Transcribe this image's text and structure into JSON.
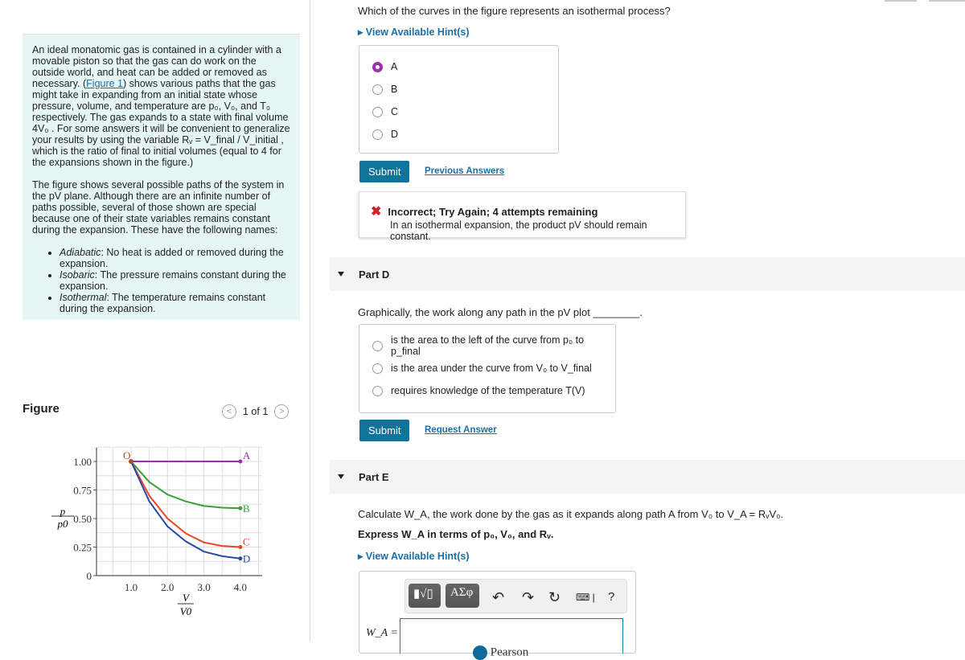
{
  "intro": {
    "p1_a": "An ideal monatomic gas is contained in a cylinder with a movable piston so that the gas can do work on the outside world, and heat can be added or removed as necessary. (",
    "figure_link": "Figure 1",
    "p1_b": ") shows various paths that the gas might take in expanding from an initial state whose pressure, volume, and temperature are p₀, V₀, and T₀ respectively. The gas expands to a state with final volume 4V₀ . For some answers it will be convenient to generalize your results by using the variable Rᵥ = V_final / V_initial , which is the ratio of final to initial volumes (equal to 4 for the expansions shown in the figure.)",
    "p2": "The figure shows several possible paths of the system in the pV plane. Although there are an infinite number of paths possible, several of those shown are special because one of their state variables remains constant during the expansion. These have the following names:",
    "bullets": [
      {
        "term": "Adiabatic",
        "text": ": No heat is added or removed during the expansion."
      },
      {
        "term": "Isobaric",
        "text": ": The pressure remains constant during the expansion."
      },
      {
        "term": "Isothermal",
        "text": ": The temperature remains constant during the expansion."
      }
    ]
  },
  "figure": {
    "title": "Figure",
    "pager": "1 of 1",
    "prev_icon": "chevron-left",
    "next_icon": "chevron-right"
  },
  "chart_data": {
    "type": "line",
    "ylabel_num": "p",
    "ylabel_den": "p0",
    "xlabel_num": "V",
    "xlabel_den": "V0",
    "xticks": [
      "1.0",
      "2.0",
      "3.0",
      "4.0"
    ],
    "yticks": [
      "0",
      "0.25",
      "0.50",
      "0.75",
      "1.00"
    ],
    "xlim": [
      0,
      4.6
    ],
    "ylim": [
      0,
      1.12
    ],
    "grid": true,
    "origin_label": "O",
    "series": [
      {
        "name": "A",
        "color": "#9b2fae",
        "x": [
          1,
          4
        ],
        "y": [
          1,
          1
        ]
      },
      {
        "name": "B",
        "color": "#3a9e3a",
        "x": [
          1,
          1.5,
          2,
          2.5,
          3,
          3.5,
          4
        ],
        "y": [
          1,
          0.82,
          0.71,
          0.65,
          0.61,
          0.595,
          0.59
        ]
      },
      {
        "name": "C",
        "color": "#ee4422",
        "x": [
          1,
          1.5,
          2,
          2.5,
          3,
          3.5,
          4
        ],
        "y": [
          1,
          0.7,
          0.5,
          0.37,
          0.29,
          0.26,
          0.25
        ]
      },
      {
        "name": "D",
        "color": "#2a4aa8",
        "x": [
          1,
          1.5,
          2,
          2.5,
          3,
          3.5,
          4
        ],
        "y": [
          1,
          0.65,
          0.43,
          0.3,
          0.21,
          0.17,
          0.15
        ]
      }
    ]
  },
  "partC": {
    "question": "Which of the curves in the figure represents an isothermal process?",
    "hint": "View Available Hint(s)",
    "options": [
      "A",
      "B",
      "C",
      "D"
    ],
    "selected": 0,
    "submit": "Submit",
    "previous": "Previous Answers",
    "feedback_title": "Incorrect; Try Again; 4 attempts remaining",
    "feedback_text": "In an isothermal expansion, the product pV should remain constant."
  },
  "partD": {
    "label": "Part D",
    "question": "Graphically, the work along any path in the pV plot ________.",
    "options": [
      "is the area to the left of the curve from p₀ to p_final",
      "is the area under the curve from V₀ to V_final",
      "requires knowledge of the temperature T(V)"
    ],
    "submit": "Submit",
    "request": "Request Answer"
  },
  "partE": {
    "label": "Part E",
    "question": "Calculate W_A, the work done by the gas as it expands along path A from V₀ to V_A = RᵥV₀.",
    "express": "Express W_A in terms of p₀, V₀, and Rᵥ.",
    "hint": "View Available Hint(s)",
    "tool_template": "▮√▯",
    "tool_greek": "ΑΣφ",
    "help": "?",
    "answer_label": "W_A =",
    "answer_value": "",
    "brand": "Pearson"
  }
}
